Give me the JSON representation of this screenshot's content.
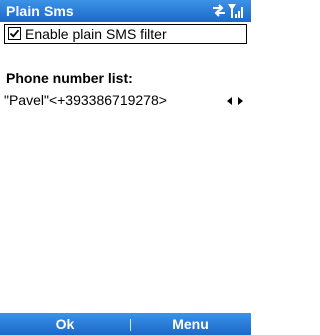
{
  "app": {
    "title": "Plain Sms"
  },
  "status_icons": [
    "connectivity-icon",
    "signal-strength-icon"
  ],
  "filter": {
    "label": "Enable plain SMS filter",
    "checked": true
  },
  "phone_list": {
    "heading": "Phone number list:",
    "selected_value": "\"Pavel\"<+393386719278>"
  },
  "softkeys": {
    "left_label": "Ok",
    "right_label": "Menu"
  },
  "colors": {
    "bar_top": "#3b93e6",
    "bar_bottom": "#1c68c9",
    "text": "#000000",
    "background": "#ffffff"
  }
}
